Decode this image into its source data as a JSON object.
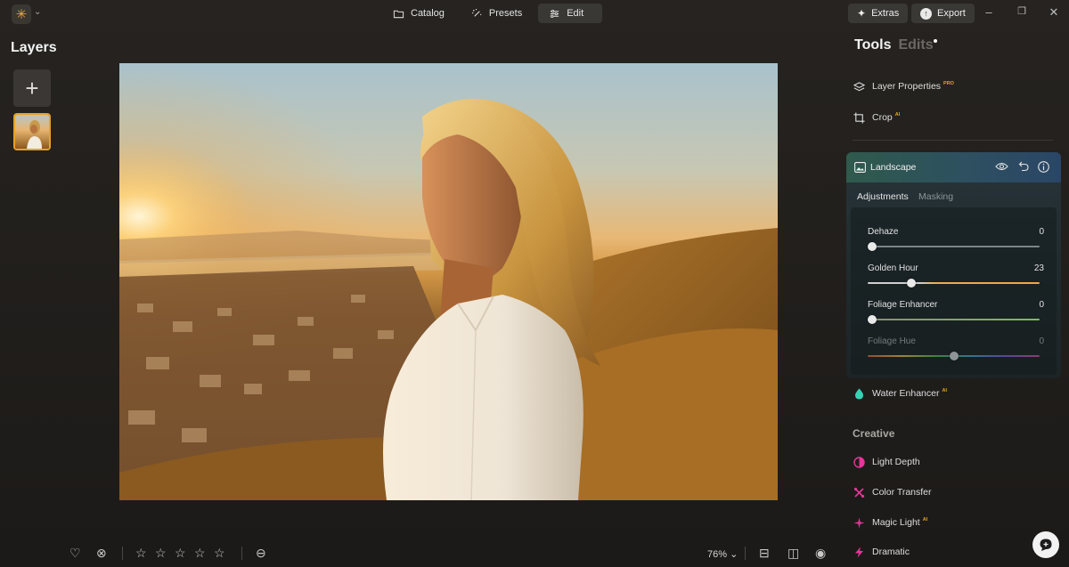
{
  "window": {
    "tabs": [
      {
        "label": "Catalog",
        "icon": "folder-icon"
      },
      {
        "label": "Presets",
        "icon": "sparkle-wand-icon"
      },
      {
        "label": "Edit",
        "icon": "sliders-icon",
        "active": true
      }
    ],
    "extras_label": "Extras",
    "export_label": "Export"
  },
  "layers": {
    "title": "Layers"
  },
  "bottom_bar": {
    "zoom": "76%",
    "stars": 5
  },
  "right_panel": {
    "tools_label": "Tools",
    "edits_label": "Edits",
    "tools": [
      {
        "label": "Layer Properties",
        "badge": "PRO"
      },
      {
        "label": "Crop",
        "badge": "AI"
      }
    ],
    "landscape": {
      "title": "Landscape",
      "tab_adjustments": "Adjustments",
      "tab_masking": "Masking",
      "sliders": [
        {
          "label": "Dehaze",
          "value": "0"
        },
        {
          "label": "Golden Hour",
          "value": "23"
        },
        {
          "label": "Foliage Enhancer",
          "value": "0"
        },
        {
          "label": "Foliage Hue",
          "value": "0"
        }
      ]
    },
    "water_enhancer": {
      "label": "Water Enhancer",
      "badge": "AI"
    },
    "creative_title": "Creative",
    "creative_tools": [
      {
        "label": "Light Depth",
        "badge": ""
      },
      {
        "label": "Color Transfer",
        "badge": ""
      },
      {
        "label": "Magic Light",
        "badge": "AI"
      },
      {
        "label": "Dramatic",
        "badge": ""
      }
    ]
  },
  "colors": {
    "accent_orange": "#e8a126",
    "landscape_header": "#2e5060",
    "creative_pink": "#e8359a"
  }
}
